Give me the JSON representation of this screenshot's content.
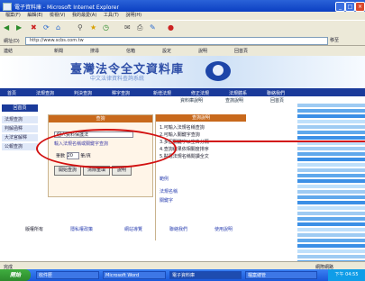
{
  "window": {
    "title": "電子資料庫 - Microsoft Internet Explorer",
    "minimize": "_",
    "maximize": "□",
    "close": "×"
  },
  "menubar": [
    "檔案(F)",
    "編輯(E)",
    "檢視(V)",
    "我的最愛(A)",
    "工具(T)",
    "說明(H)"
  ],
  "address": {
    "label": "網址(D)",
    "value": "http://www.scbs.com.tw",
    "go": "移至"
  },
  "links": [
    "連結",
    "新聞",
    "搜尋",
    "信箱",
    "設定",
    "說明",
    "回首頁"
  ],
  "banner": {
    "title": "臺灣法令全文資料庫",
    "subtitle": "中文法律資料查詢系統"
  },
  "navbar": [
    "首頁",
    "法規查詢",
    "判決查詢",
    "釋字查詢",
    "新增法規",
    "修正法規",
    "法規體系",
    "聯絡我們"
  ],
  "subnav": [
    "資料庫說明",
    "查詢說明",
    "回首頁"
  ],
  "sidebar": {
    "home": "回首頁",
    "items": [
      "法規查詢",
      "判解函釋",
      "大法官解釋",
      "公報查詢"
    ]
  },
  "form": {
    "header": "查詢",
    "keyword_value": "個人資料保護法",
    "hint": "輸入法規名稱或關鍵字查詢",
    "limit_label": "筆數",
    "limit_value": "20",
    "limit_unit": "筆/頁",
    "buttons": [
      "開始查詢",
      "清除重填",
      "說明"
    ]
  },
  "help": {
    "header": "查詢說明",
    "lines": [
      "1.可輸入法規名稱查詢",
      "2.可輸入關鍵字查詢",
      "3.多個關鍵字以空白分隔",
      "4.查詢結果依相關度排序",
      "5.點選法規名稱閱讀全文",
      "範例",
      "法規名稱",
      "關鍵字"
    ]
  },
  "footer": [
    "版權所有",
    "隱私權政策",
    "網站導覽",
    "聯絡我們",
    "使用說明"
  ],
  "statusbar": {
    "text": "完成",
    "zone": "網際網路"
  },
  "taskbar": {
    "start": "開始",
    "tasks": [
      "收件匣",
      "Microsoft Word",
      "電子資料庫",
      "檔案總管"
    ],
    "clock": "下午 04:55"
  },
  "colors": {
    "accent": "#c8691c",
    "nav": "#1a3a9a",
    "annotation": "#d21010"
  }
}
